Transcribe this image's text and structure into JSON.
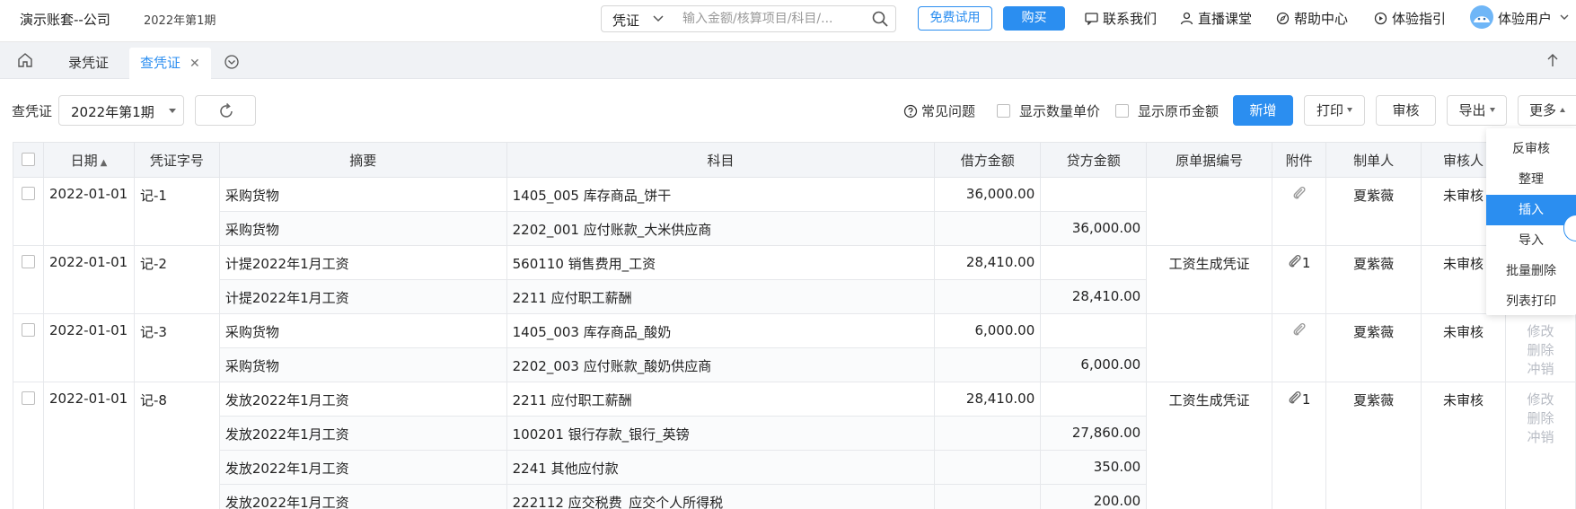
{
  "header": {
    "app_title": "演示账套--公司",
    "period": "2022年第1期",
    "search": {
      "type": "凭证",
      "placeholder": "输入金额/核算项目/科目/..."
    },
    "trial_label": "免费试用",
    "buy_label": "购买",
    "links": [
      "联系我们",
      "直播课堂",
      "帮助中心",
      "体验指引"
    ],
    "user_name": "体验用户"
  },
  "tabs": {
    "items": [
      {
        "label": "录凭证",
        "active": false
      },
      {
        "label": "查凭证",
        "active": true
      }
    ]
  },
  "toolbar": {
    "label": "查凭证",
    "period_value": "2022年第1期",
    "faq_label": "常见问题",
    "show_qty_price": "显示数量单价",
    "show_fx_amount": "显示原币金额",
    "new_label": "新增",
    "print_label": "打印",
    "audit_label": "审核",
    "export_label": "导出",
    "more_label": "更多"
  },
  "more_menu": {
    "items": [
      "反审核",
      "整理",
      "插入",
      "导入",
      "批量删除",
      "列表打印"
    ],
    "active_index": 2
  },
  "table": {
    "columns": [
      "日期",
      "凭证字号",
      "摘要",
      "科目",
      "借方金额",
      "贷方金额",
      "原单据编号",
      "附件",
      "制单人",
      "审核人"
    ],
    "row_actions": [
      "修改",
      "删除",
      "冲销"
    ],
    "vouchers": [
      {
        "date": "2022-01-01",
        "no": "记-1",
        "source": "",
        "attachment": "",
        "maker": "夏紫薇",
        "auditor": "未审核",
        "lines": [
          {
            "summary": "采购货物",
            "account": "1405_005 库存商品_饼干",
            "debit": "36,000.00",
            "credit": ""
          },
          {
            "summary": "采购货物",
            "account": "2202_001 应付账款_大米供应商",
            "debit": "",
            "credit": "36,000.00"
          }
        ]
      },
      {
        "date": "2022-01-01",
        "no": "记-2",
        "source": "工资生成凭证",
        "attachment": "1",
        "maker": "夏紫薇",
        "auditor": "未审核",
        "lines": [
          {
            "summary": "计提2022年1月工资",
            "account": "560110 销售费用_工资",
            "debit": "28,410.00",
            "credit": ""
          },
          {
            "summary": "计提2022年1月工资",
            "account": "2211 应付职工薪酬",
            "debit": "",
            "credit": "28,410.00"
          }
        ]
      },
      {
        "date": "2022-01-01",
        "no": "记-3",
        "source": "",
        "attachment": "",
        "maker": "夏紫薇",
        "auditor": "未审核",
        "lines": [
          {
            "summary": "采购货物",
            "account": "1405_003 库存商品_酸奶",
            "debit": "6,000.00",
            "credit": ""
          },
          {
            "summary": "采购货物",
            "account": "2202_003 应付账款_酸奶供应商",
            "debit": "",
            "credit": "6,000.00"
          }
        ]
      },
      {
        "date": "2022-01-01",
        "no": "记-8",
        "source": "工资生成凭证",
        "attachment": "1",
        "maker": "夏紫薇",
        "auditor": "未审核",
        "lines": [
          {
            "summary": "发放2022年1月工资",
            "account": "2211 应付职工薪酬",
            "debit": "28,410.00",
            "credit": ""
          },
          {
            "summary": "发放2022年1月工资",
            "account": "100201 银行存款_银行_英镑",
            "debit": "",
            "credit": "27,860.00"
          },
          {
            "summary": "发放2022年1月工资",
            "account": "2241 其他应付款",
            "debit": "",
            "credit": "350.00"
          },
          {
            "summary": "发放2022年1月工资",
            "account": "222112 应交税费_应交个人所得税",
            "debit": "",
            "credit": "200.00"
          }
        ]
      }
    ]
  },
  "colors": {
    "accent": "#2b8ef0",
    "header_bg": "#f3f5f8",
    "muted_action": "#b8bcc4"
  }
}
